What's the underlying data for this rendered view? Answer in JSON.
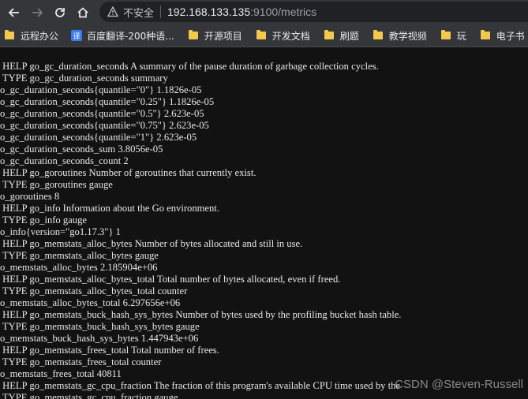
{
  "browser": {
    "insecure_label": "不安全",
    "url_host": "192.168.133.135",
    "url_rest": ":9100/metrics"
  },
  "bookmarks": [
    {
      "label": "远程办公",
      "icon": "folder-icon"
    },
    {
      "label": "百度翻译-200种语...",
      "icon": "fanyi-icon"
    },
    {
      "label": "开源项目",
      "icon": "folder-icon"
    },
    {
      "label": "开发文档",
      "icon": "folder-icon"
    },
    {
      "label": "刷题",
      "icon": "folder-icon"
    },
    {
      "label": "教学视频",
      "icon": "folder-icon"
    },
    {
      "label": "玩",
      "icon": "folder-icon"
    },
    {
      "label": "电子书",
      "icon": "folder-icon"
    }
  ],
  "metrics_lines": [
    " HELP go_gc_duration_seconds A summary of the pause duration of garbage collection cycles.",
    " TYPE go_gc_duration_seconds summary",
    "o_gc_duration_seconds{quantile=\"0\"} 1.1826e-05",
    "o_gc_duration_seconds{quantile=\"0.25\"} 1.1826e-05",
    "o_gc_duration_seconds{quantile=\"0.5\"} 2.623e-05",
    "o_gc_duration_seconds{quantile=\"0.75\"} 2.623e-05",
    "o_gc_duration_seconds{quantile=\"1\"} 2.623e-05",
    "o_gc_duration_seconds_sum 3.8056e-05",
    "o_gc_duration_seconds_count 2",
    " HELP go_goroutines Number of goroutines that currently exist.",
    " TYPE go_goroutines gauge",
    "o_goroutines 8",
    " HELP go_info Information about the Go environment.",
    " TYPE go_info gauge",
    "o_info{version=\"go1.17.3\"} 1",
    " HELP go_memstats_alloc_bytes Number of bytes allocated and still in use.",
    " TYPE go_memstats_alloc_bytes gauge",
    "o_memstats_alloc_bytes 2.185904e+06",
    " HELP go_memstats_alloc_bytes_total Total number of bytes allocated, even if freed.",
    " TYPE go_memstats_alloc_bytes_total counter",
    "o_memstats_alloc_bytes_total 6.297656e+06",
    " HELP go_memstats_buck_hash_sys_bytes Number of bytes used by the profiling bucket hash table.",
    " TYPE go_memstats_buck_hash_sys_bytes gauge",
    "o_memstats_buck_hash_sys_bytes 1.447943e+06",
    " HELP go_memstats_frees_total Total number of frees.",
    " TYPE go_memstats_frees_total counter",
    "o_memstats_frees_total 40811",
    " HELP go_memstats_gc_cpu_fraction The fraction of this program's available CPU time used by the",
    " TYPE go_memstats_gc_cpu_fraction gauge"
  ],
  "watermark": "CSDN @Steven-Russell"
}
